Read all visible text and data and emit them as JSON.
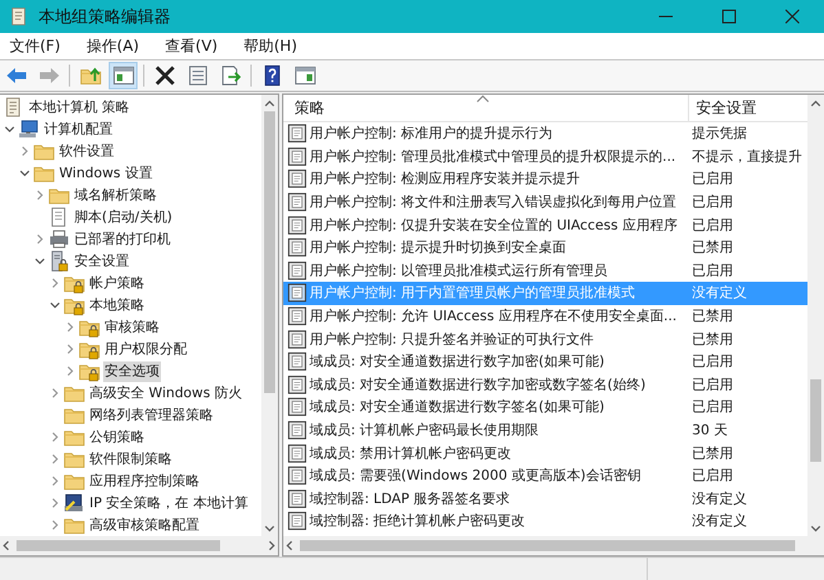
{
  "window": {
    "title": "本地组策略编辑器"
  },
  "menu": [
    {
      "label": "文件(F)"
    },
    {
      "label": "操作(A)"
    },
    {
      "label": "查看(V)"
    },
    {
      "label": "帮助(H)"
    }
  ],
  "toolbar": [
    [
      {
        "kind": "back",
        "disabled": false,
        "pressed": false
      },
      {
        "kind": "forward",
        "disabled": true,
        "pressed": false
      }
    ],
    [
      {
        "kind": "up",
        "disabled": false,
        "pressed": false
      },
      {
        "kind": "treepane",
        "disabled": false,
        "pressed": true
      }
    ],
    [
      {
        "kind": "delete",
        "disabled": false,
        "pressed": false
      },
      {
        "kind": "properties",
        "disabled": false,
        "pressed": false
      },
      {
        "kind": "export",
        "disabled": false,
        "pressed": false
      }
    ],
    [
      {
        "kind": "help",
        "disabled": false,
        "pressed": false
      },
      {
        "kind": "actionpane",
        "disabled": false,
        "pressed": false
      }
    ]
  ],
  "tree": [
    {
      "label": "本地计算机 策略",
      "kind": "document",
      "selected": false,
      "children": [
        {
          "label": "计算机配置",
          "kind": "computer",
          "expanded": true,
          "selected": false,
          "children": [
            {
              "label": "软件设置",
              "kind": "folder",
              "expanded": false,
              "selected": false
            },
            {
              "label": "Windows 设置",
              "kind": "folder",
              "expanded": true,
              "selected": false,
              "children": [
                {
                  "label": "域名解析策略",
                  "kind": "folder",
                  "expanded": false,
                  "selected": false
                },
                {
                  "label": "脚本(启动/关机)",
                  "kind": "script",
                  "selected": false
                },
                {
                  "label": "已部署的打印机",
                  "kind": "printer",
                  "expanded": false,
                  "selected": false
                },
                {
                  "label": "安全设置",
                  "kind": "security",
                  "expanded": true,
                  "selected": false,
                  "children": [
                    {
                      "label": "帐户策略",
                      "kind": "lockfolder",
                      "expanded": false,
                      "selected": false
                    },
                    {
                      "label": "本地策略",
                      "kind": "lockfolder",
                      "expanded": true,
                      "selected": false,
                      "children": [
                        {
                          "label": "审核策略",
                          "kind": "lockfolder",
                          "expanded": false,
                          "selected": false
                        },
                        {
                          "label": "用户权限分配",
                          "kind": "lockfolder",
                          "expanded": false,
                          "selected": false
                        },
                        {
                          "label": "安全选项",
                          "kind": "lockfolder",
                          "expanded": false,
                          "selected": true
                        }
                      ]
                    },
                    {
                      "label": "高级安全 Windows 防火",
                      "kind": "folder",
                      "expanded": false,
                      "selected": false
                    },
                    {
                      "label": "网络列表管理器策略",
                      "kind": "folder",
                      "selected": false
                    },
                    {
                      "label": "公钥策略",
                      "kind": "folder",
                      "expanded": false,
                      "selected": false
                    },
                    {
                      "label": "软件限制策略",
                      "kind": "folder",
                      "expanded": false,
                      "selected": false
                    },
                    {
                      "label": "应用程序控制策略",
                      "kind": "folder",
                      "expanded": false,
                      "selected": false
                    },
                    {
                      "label": "IP 安全策略，在 本地计算",
                      "kind": "network",
                      "expanded": false,
                      "selected": false
                    },
                    {
                      "label": "高级审核策略配置",
                      "kind": "folder",
                      "expanded": false,
                      "selected": false
                    }
                  ]
                }
              ]
            }
          ]
        }
      ]
    }
  ],
  "table": {
    "columns": [
      {
        "label": "策略"
      },
      {
        "label": "安全设置"
      }
    ],
    "rows": [
      {
        "policy": "用户帐户控制: 标准用户的提升提示行为",
        "setting": "提示凭据",
        "selected": false
      },
      {
        "policy": "用户帐户控制: 管理员批准模式中管理员的提升权限提示的...",
        "setting": "不提示，直接提升",
        "selected": false
      },
      {
        "policy": "用户帐户控制: 检测应用程序安装并提示提升",
        "setting": "已启用",
        "selected": false
      },
      {
        "policy": "用户帐户控制: 将文件和注册表写入错误虚拟化到每用户位置",
        "setting": "已启用",
        "selected": false
      },
      {
        "policy": "用户帐户控制: 仅提升安装在安全位置的 UIAccess 应用程序",
        "setting": "已启用",
        "selected": false
      },
      {
        "policy": "用户帐户控制: 提示提升时切换到安全桌面",
        "setting": "已禁用",
        "selected": false
      },
      {
        "policy": "用户帐户控制: 以管理员批准模式运行所有管理员",
        "setting": "已启用",
        "selected": false
      },
      {
        "policy": "用户帐户控制: 用于内置管理员帐户的管理员批准模式",
        "setting": "没有定义",
        "selected": true
      },
      {
        "policy": "用户帐户控制: 允许 UIAccess 应用程序在不使用安全桌面...",
        "setting": "已禁用",
        "selected": false
      },
      {
        "policy": "用户帐户控制: 只提升签名并验证的可执行文件",
        "setting": "已禁用",
        "selected": false
      },
      {
        "policy": "域成员: 对安全通道数据进行数字加密(如果可能)",
        "setting": "已启用",
        "selected": false
      },
      {
        "policy": "域成员: 对安全通道数据进行数字加密或数字签名(始终)",
        "setting": "已启用",
        "selected": false
      },
      {
        "policy": "域成员: 对安全通道数据进行数字签名(如果可能)",
        "setting": "已启用",
        "selected": false
      },
      {
        "policy": "域成员: 计算机帐户密码最长使用期限",
        "setting": "30 天",
        "selected": false
      },
      {
        "policy": "域成员: 禁用计算机帐户密码更改",
        "setting": "已禁用",
        "selected": false
      },
      {
        "policy": "域成员: 需要强(Windows 2000 或更高版本)会话密钥",
        "setting": "已启用",
        "selected": false
      },
      {
        "policy": "域控制器: LDAP 服务器签名要求",
        "setting": "没有定义",
        "selected": false
      },
      {
        "policy": "域控制器: 拒绝计算机帐户密码更改",
        "setting": "没有定义",
        "selected": false
      }
    ]
  }
}
